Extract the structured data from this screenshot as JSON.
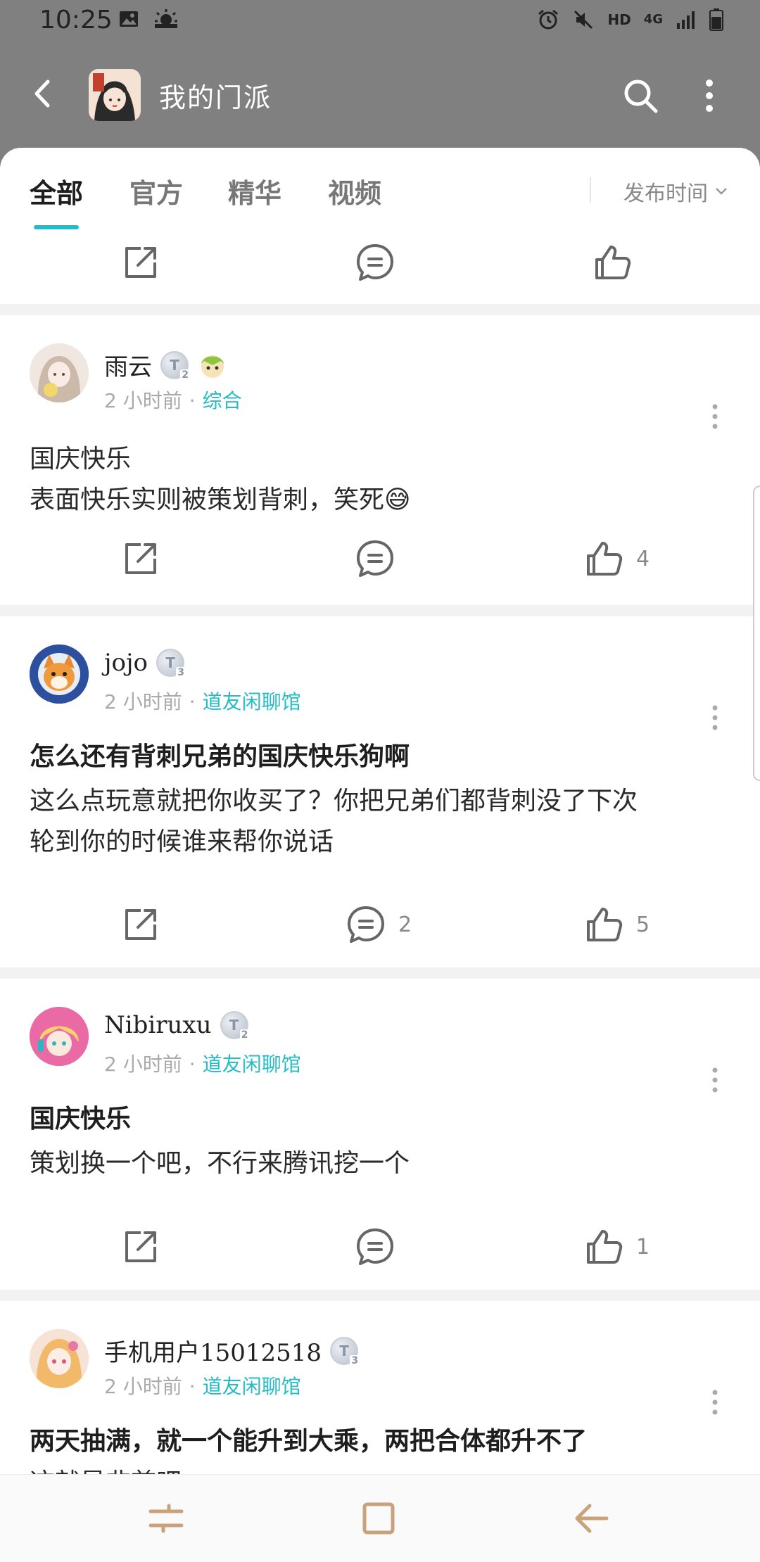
{
  "status_bar": {
    "time": "10:25",
    "network_hd": "HD",
    "network_4g": "4G"
  },
  "app_bar": {
    "title": "我的门派",
    "icons": [
      "back-arrow-icon",
      "search-icon",
      "more-vertical-icon"
    ]
  },
  "tabs": {
    "items": [
      {
        "label": "全部",
        "active": true
      },
      {
        "label": "官方",
        "active": false
      },
      {
        "label": "精华",
        "active": false
      },
      {
        "label": "视频",
        "active": false
      }
    ],
    "sort_label": "发布时间"
  },
  "top_action_bar": {
    "icons": [
      "share-icon",
      "comment-icon",
      "like-icon"
    ]
  },
  "posts": [
    {
      "username": "雨云",
      "level": "2",
      "time": "2 小时前",
      "category": "综合",
      "title": "",
      "body_lines": [
        "国庆快乐",
        "表面快乐实则被策划背刺，笑死😅"
      ],
      "comments": "",
      "likes": "4"
    },
    {
      "username": "jojo",
      "level": "3",
      "time": "2 小时前",
      "category": "道友闲聊馆",
      "title": "怎么还有背刺兄弟的国庆快乐狗啊",
      "body_lines": [
        "这么点玩意就把你收买了？你把兄弟们都背刺没了下次",
        "轮到你的时候谁来帮你说话"
      ],
      "comments": "2",
      "likes": "5"
    },
    {
      "username": "Nibiruxu",
      "level": "2",
      "time": "2 小时前",
      "category": "道友闲聊馆",
      "title": "国庆快乐",
      "body_lines": [
        "策划换一个吧，不行来腾讯挖一个"
      ],
      "comments": "",
      "likes": "1"
    },
    {
      "username": "手机用户15012518",
      "level": "3",
      "time": "2 小时前",
      "category": "道友闲聊馆",
      "title": "两天抽满，就一个能升到大乘，两把合体都升不了",
      "body_lines": [
        "这就是非酋吧"
      ],
      "comments": "",
      "likes": ""
    }
  ],
  "badge_letter": "T",
  "separator": "·",
  "colors": {
    "accent": "#26bcc6",
    "header_bg": "#808080",
    "card_bg": "#ffffff",
    "nav_icon": "#c9a27a"
  },
  "nav_bar": {
    "icons": [
      "recent-apps-icon",
      "home-icon",
      "back-icon"
    ]
  }
}
